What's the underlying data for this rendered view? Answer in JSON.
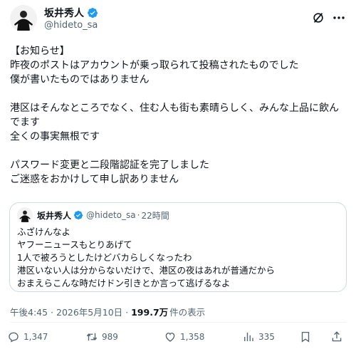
{
  "author": {
    "display_name": "坂井秀人",
    "handle": "@hideto_sa"
  },
  "post": {
    "lines": [
      "【お知らせ】",
      "昨夜のポストはアカウントが乗っ取られて投稿されたものでした",
      "僕が書いたものではありません",
      "",
      "港区はそんなところでなく、住む人も街も素晴らしく、みんな上品に飲ん",
      "でます",
      "全くの事実無根です",
      "",
      "パスワード変更と二段階認証を完了しました",
      "ご迷惑をおかけして申し訳ありません"
    ]
  },
  "quote": {
    "display_name": "坂井秀人",
    "handle": "@hideto_sa",
    "dot": "·",
    "time": "22時間",
    "lines": [
      "ふざけんなよ",
      "ヤフーニュースもとりあげて",
      "1人で被ろうとしたけどバカらしくなったわ",
      "港区いない人は分からないだけで、港区の夜はあれが普通だから",
      "おまえらこんな時だけドン引きとか言って逃げるなよ"
    ]
  },
  "meta": {
    "timestamp": "午後4:45 · 2026年5月10日 · ",
    "views": "199.7万",
    "views_suffix": "件の表示"
  },
  "actions": {
    "replies": "1,347",
    "reposts": "989",
    "likes": "1,358",
    "views": "335"
  },
  "colors": {
    "verified": "#1d9bf0",
    "secondary_text": "#536471",
    "border": "#cfd9de"
  },
  "icons": [
    "verified-badge-icon",
    "grok-icon",
    "more-icon",
    "reply-icon",
    "repost-icon",
    "like-icon",
    "views-icon",
    "bookmark-icon",
    "share-icon"
  ]
}
